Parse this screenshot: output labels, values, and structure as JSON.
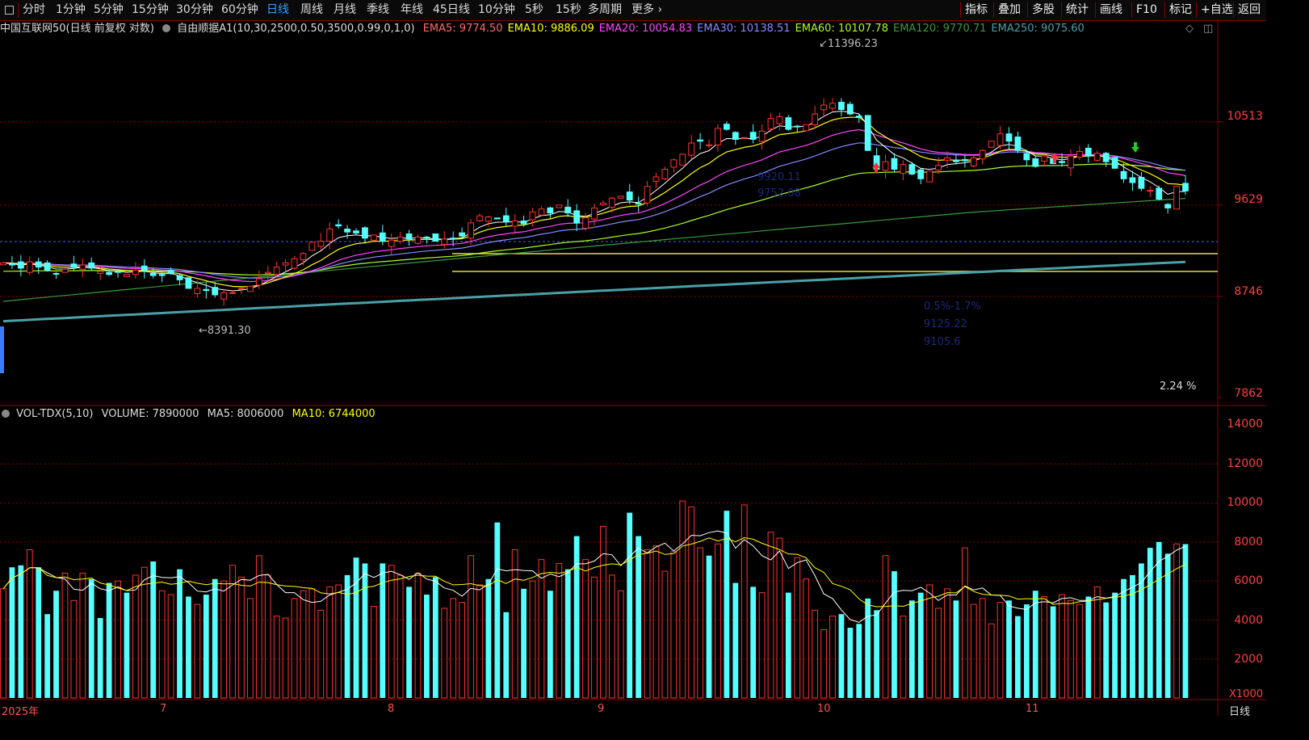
{
  "toolbar": {
    "square_icon": "square-icon",
    "left_items": [
      "分时",
      "1分钟",
      "5分钟",
      "15分钟",
      "30分钟",
      "60分钟",
      "日线",
      "周线",
      "月线",
      "季线",
      "年线",
      "45日线",
      "10分钟",
      "5秒",
      "15秒",
      "多周期",
      "更多"
    ],
    "active_item": "日线",
    "right_items": [
      "指标",
      "叠加",
      "多股",
      "统计",
      "画线",
      "F10",
      "标记",
      "+自选",
      "返回"
    ]
  },
  "main_panel": {
    "title": "中国互联网50(日线 前复权 对数)",
    "indicator": "自由顺据A1(10,30,2500,0.50,3500,0.99,0,1,0)",
    "ema": [
      {
        "label": "EMA5: 9774.50",
        "color": "#ff6a6a"
      },
      {
        "label": "EMA10: 9886.09",
        "color": "#ffff00"
      },
      {
        "label": "EMA20: 10054.83",
        "color": "#ff44ff"
      },
      {
        "label": "EMA30: 10138.51",
        "color": "#8888ff"
      },
      {
        "label": "EMA60: 10107.78",
        "color": "#aaff22"
      },
      {
        "label": "EMA120: 9770.71",
        "color": "#3a9a3a"
      },
      {
        "label": "EMA250: 9075.60",
        "color": "#4aa0a8"
      }
    ],
    "y_axis": [
      "10513",
      "9629",
      "8746",
      "7862"
    ],
    "high_label": "11396.23",
    "low_label": "8391.30",
    "percent_label": "2.24 %",
    "faint_labels": [
      "9920.11",
      "9752.08",
      "0.5%-1.7%",
      "9125.22",
      "9105.6"
    ]
  },
  "volume_panel": {
    "title": "VOL-TDX(5,10)",
    "volume": "VOLUME: 7890000",
    "ma5": "MA5: 8006000",
    "ma10": "MA10: 6744000",
    "y_axis": [
      "14000",
      "12000",
      "10000",
      "8000",
      "6000",
      "4000",
      "2000"
    ],
    "unit": "X1000"
  },
  "date_axis": {
    "labels": [
      "2025年",
      "7",
      "8",
      "9",
      "10",
      "11"
    ],
    "period": "日线"
  },
  "colors": {
    "up": "#ff3030",
    "down": "#55ffff",
    "grid": "#8b0000",
    "ema5": "#ffffff",
    "ema10": "#ffff00"
  },
  "chart_data": {
    "type": "candlestick",
    "title": "中国互联网50(日线 前复权 对数)",
    "price_ylim": [
      7862,
      11396.23
    ],
    "volume_ylim": [
      0,
      14000
    ],
    "closes": [
      9060,
      9040,
      9010,
      9070,
      9020,
      8990,
      8960,
      9000,
      9020,
      9040,
      9010,
      8980,
      8950,
      8970,
      8950,
      8990,
      8990,
      8940,
      8940,
      8960,
      8900,
      8820,
      8820,
      8800,
      8760,
      8780,
      8780,
      8820,
      8840,
      8910,
      8970,
      9020,
      9060,
      9100,
      9150,
      9260,
      9270,
      9390,
      9420,
      9360,
      9350,
      9300,
      9330,
      9270,
      9280,
      9310,
      9290,
      9310,
      9300,
      9270,
      9290,
      9300,
      9320,
      9450,
      9520,
      9510,
      9490,
      9460,
      9470,
      9440,
      9560,
      9590,
      9550,
      9630,
      9550,
      9450,
      9500,
      9600,
      9650,
      9700,
      9720,
      9680,
      9640,
      9820,
      9920,
      10000,
      10100,
      10160,
      10280,
      10300,
      10260,
      10440,
      10430,
      10320,
      10340,
      10320,
      10410,
      10550,
      10570,
      10430,
      10460,
      10480,
      10600,
      10700,
      10720,
      10650,
      10600,
      10560,
      10200,
      10000,
      10080,
      10000,
      10050,
      9950,
      9900,
      9980,
      10040,
      10120,
      10080,
      10090,
      10120,
      10200,
      10300,
      10380,
      10300,
      10200,
      10100,
      10030,
      10140,
      10060,
      10070,
      10140,
      10190,
      10140,
      10170,
      10080,
      10010,
      9900,
      9860,
      9800,
      9780,
      9690,
      9600,
      9820,
      9774.5
    ],
    "volumes": [
      5600,
      6700,
      6800,
      7600,
      6700,
      4300,
      5500,
      6400,
      5000,
      6400,
      6100,
      4100,
      5900,
      6000,
      5400,
      6300,
      6700,
      7000,
      5500,
      5300,
      6600,
      5200,
      4800,
      5300,
      6100,
      6000,
      6800,
      6200,
      5100,
      7300,
      6300,
      4200,
      4100,
      5100,
      5500,
      5600,
      4500,
      5700,
      5800,
      6300,
      7200,
      6900,
      4700,
      6900,
      6800,
      6300,
      5700,
      6400,
      5300,
      6200,
      4600,
      5100,
      4900,
      7300,
      5800,
      6100,
      9000,
      4400,
      7600,
      5600,
      6000,
      7100,
      5500,
      6900,
      6600,
      8300,
      7100,
      6200,
      8800,
      6300,
      5500,
      9500,
      8300,
      7600,
      7800,
      6500,
      7500,
      10100,
      9800,
      7700,
      7300,
      7900,
      9600,
      5900,
      9900,
      5700,
      5400,
      8500,
      8200,
      5400,
      7200,
      6100,
      4500,
      3500,
      4200,
      4300,
      3600,
      3800,
      5100,
      4500,
      7300,
      6500,
      4200,
      5000,
      5400,
      5800,
      4600,
      5600,
      5000,
      7700,
      4800,
      5100,
      3800,
      4900,
      5000,
      4200,
      4800,
      5500,
      5200,
      4700,
      5300,
      5000,
      4800,
      5200,
      5700,
      4900,
      5400,
      6100,
      6300,
      6900,
      7700,
      8000,
      7400,
      7900,
      7890
    ]
  }
}
